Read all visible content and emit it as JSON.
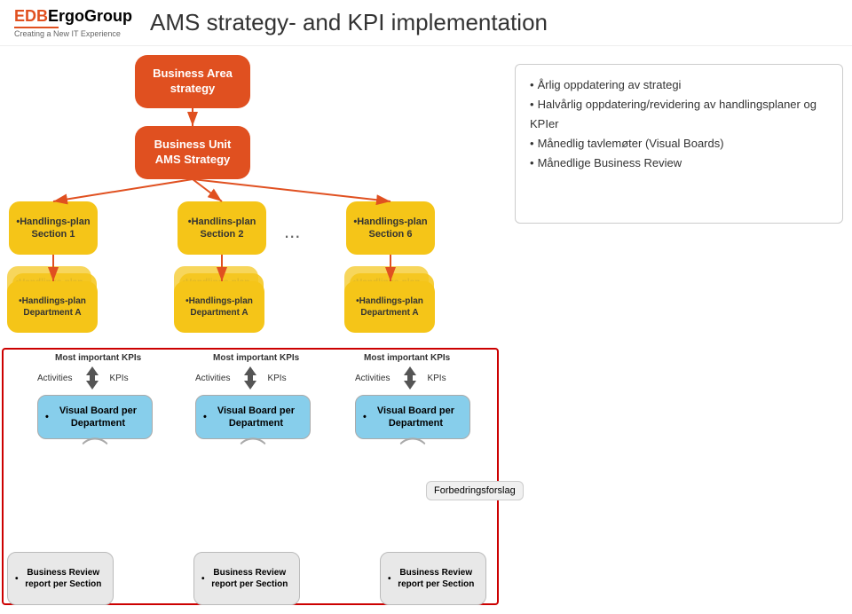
{
  "header": {
    "logo_edb": "EDB",
    "logo_ergo": "ErgoGroup",
    "logo_sub": "Creating a New IT Experience",
    "title": "AMS strategy- and KPI implementation"
  },
  "boxes": {
    "business_area": "Business Area strategy",
    "business_unit": "Business Unit AMS Strategy",
    "hp1": "Handlings-plan Section 1",
    "hp2": "Handlins-plan Section 2",
    "hp6": "Handlings-plan Section 6",
    "dots": "...",
    "hd1": "Handlings-plan Department A",
    "hd2": "Handlings-plan Department A",
    "hd3": "Handlings-plan Department A",
    "kpi_label1": "Most important KPIs",
    "kpi_label2": "Most important KPIs",
    "kpi_label3": "Most important KPIs",
    "activities1": "Activities",
    "activities2": "Activities",
    "activities3": "Activities",
    "kpis1": "KPIs",
    "kpis2": "KPIs",
    "kpis3": "KPIs",
    "visual1": "Visual Board per Department",
    "visual2": "Visual Board per Department",
    "visual3": "Visual Board per Department",
    "biz1": "Business Review report per Section",
    "biz2": "Business Review report per Section",
    "biz3": "Business Review report per Section",
    "forbedrings": "Forbedringsforslag"
  },
  "info": {
    "item1": "Årlig oppdatering av strategi",
    "item2": "Halvårlig oppdatering/revidering av handlingsplaner og KPIer",
    "item3": "Månedlig tavlemøter (Visual Boards)",
    "item4": "Månedlige Business Review"
  },
  "colors": {
    "orange": "#e05020",
    "yellow": "#f5c518",
    "light_blue": "#87ceeb",
    "light_gray": "#e8e8e8",
    "red_border": "#cc0000"
  }
}
